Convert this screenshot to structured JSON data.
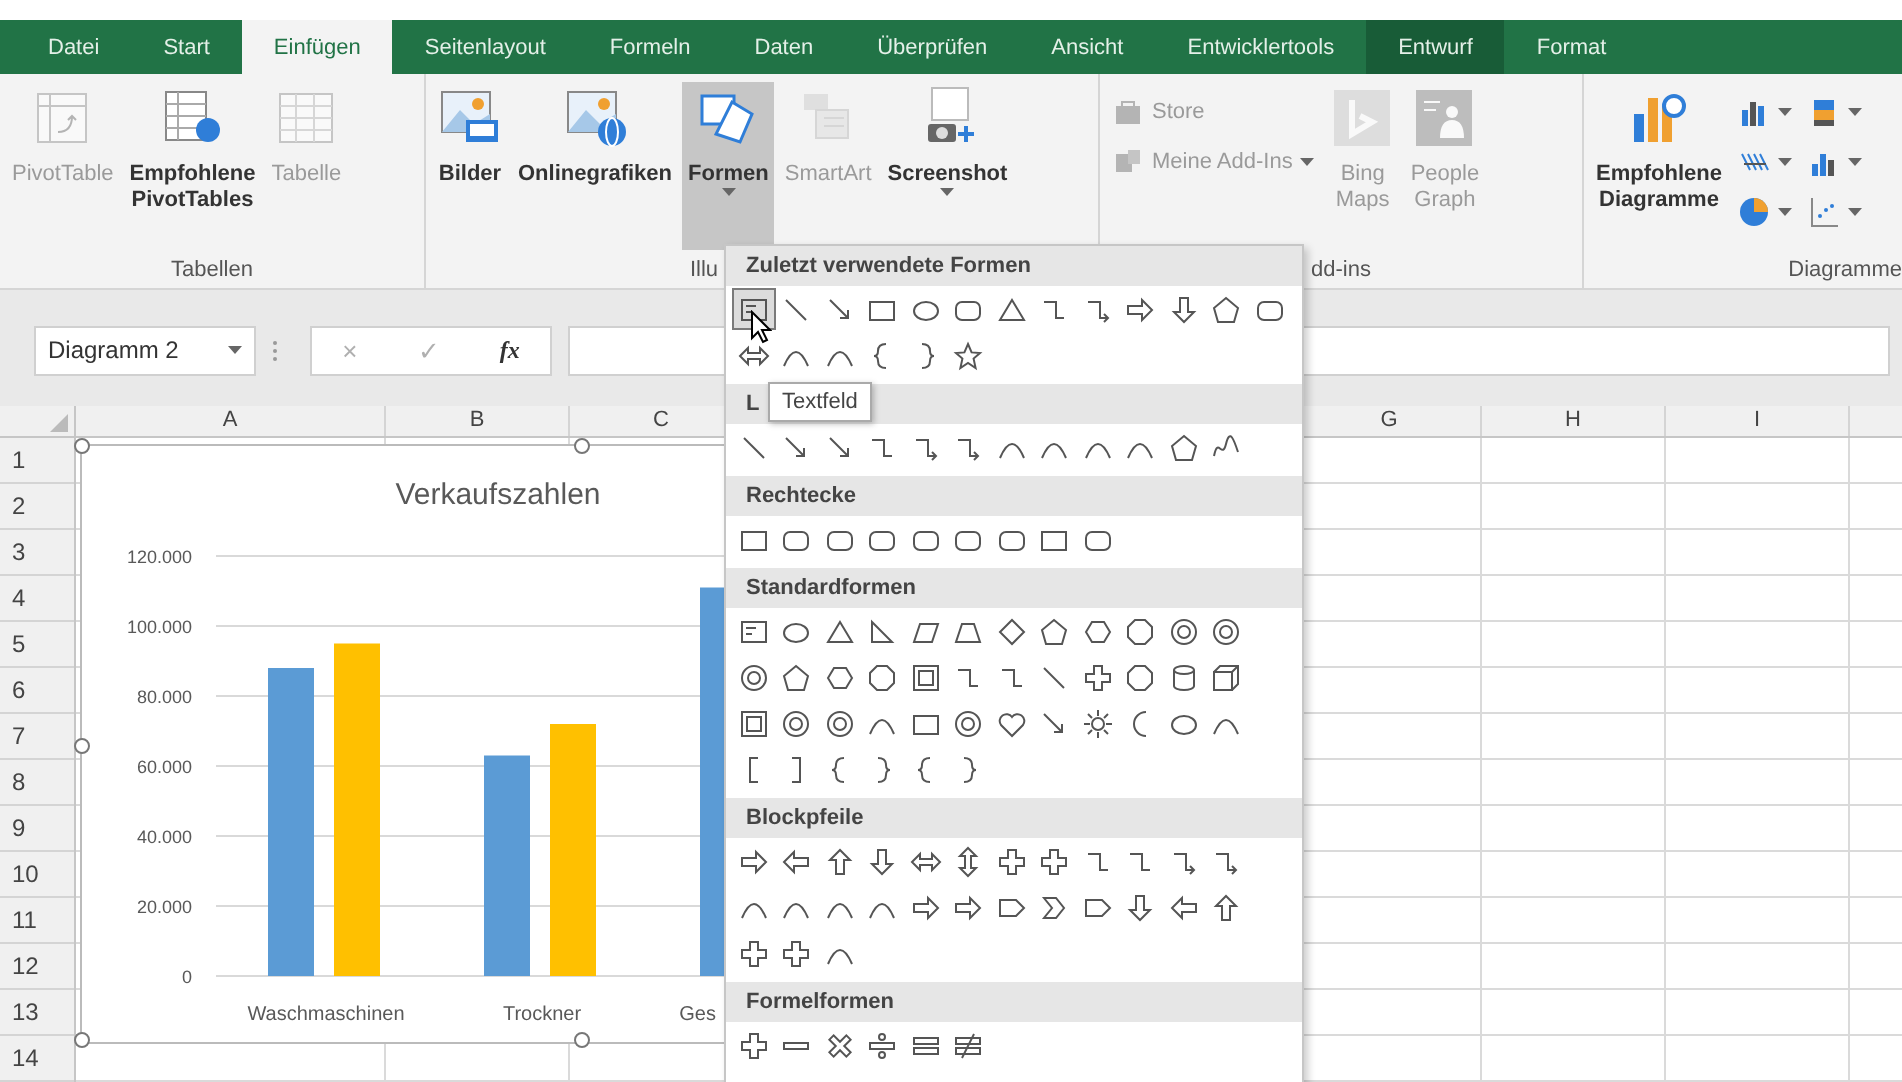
{
  "ribbon_tabs": [
    {
      "label": "Datei",
      "selected": false,
      "contextual": false
    },
    {
      "label": "Start",
      "selected": false,
      "contextual": false
    },
    {
      "label": "Einfügen",
      "selected": true,
      "contextual": false
    },
    {
      "label": "Seitenlayout",
      "selected": false,
      "contextual": false
    },
    {
      "label": "Formeln",
      "selected": false,
      "contextual": false
    },
    {
      "label": "Daten",
      "selected": false,
      "contextual": false
    },
    {
      "label": "Überprüfen",
      "selected": false,
      "contextual": false
    },
    {
      "label": "Ansicht",
      "selected": false,
      "contextual": false
    },
    {
      "label": "Entwicklertools",
      "selected": false,
      "contextual": false
    },
    {
      "label": "Entwurf",
      "selected": false,
      "contextual": true
    },
    {
      "label": "Format",
      "selected": false,
      "contextual": false
    }
  ],
  "ribbon_groups": [
    {
      "label": "Tabellen",
      "buttons": [
        {
          "kind": "large",
          "label": "PivotTable",
          "disabled": true,
          "pressed": false
        },
        {
          "kind": "large",
          "label": "Empfohlene PivotTables",
          "disabled": false,
          "pressed": false
        },
        {
          "kind": "large",
          "label": "Tabelle",
          "disabled": true,
          "pressed": false
        }
      ]
    },
    {
      "label": "Illu",
      "buttons": [
        {
          "kind": "large",
          "label": "Bilder",
          "disabled": false,
          "pressed": false
        },
        {
          "kind": "large",
          "label": "Onlinegrafiken",
          "disabled": false,
          "pressed": false
        },
        {
          "kind": "large-menu",
          "label": "Formen",
          "disabled": false,
          "pressed": true
        },
        {
          "kind": "large",
          "label": "SmartArt",
          "disabled": true,
          "pressed": false
        },
        {
          "kind": "large-menu",
          "label": "Screenshot",
          "disabled": false,
          "pressed": false
        }
      ]
    },
    {
      "label": "dd-ins",
      "buttons": [
        {
          "kind": "small",
          "label": "Store",
          "disabled": true,
          "pressed": false
        },
        {
          "kind": "small-menu",
          "label": "Meine Add-Ins",
          "disabled": true,
          "pressed": false
        },
        {
          "kind": "large",
          "label": "Bing Maps",
          "disabled": true,
          "pressed": false
        },
        {
          "kind": "large",
          "label": "People Graph",
          "disabled": true,
          "pressed": false
        }
      ]
    },
    {
      "label": "Diagramme",
      "buttons": [
        {
          "kind": "large",
          "label": "Empfohlene Diagramme",
          "disabled": false,
          "pressed": false
        },
        {
          "kind": "small-menu",
          "disabled": false,
          "pressed": false
        },
        {
          "kind": "small-menu",
          "disabled": false,
          "pressed": false
        },
        {
          "kind": "small-menu",
          "disabled": false,
          "pressed": false
        },
        {
          "kind": "small-menu",
          "disabled": false,
          "pressed": false
        },
        {
          "kind": "small-menu",
          "disabled": false,
          "pressed": false
        },
        {
          "kind": "small-menu",
          "disabled": false,
          "pressed": false
        }
      ]
    }
  ],
  "formula_bar": {
    "name_box": "Diagramm 2",
    "buttons": [
      {
        "label": "×",
        "disabled": true
      },
      {
        "label": "✓",
        "disabled": true
      },
      {
        "label": "fx",
        "disabled": false
      }
    ]
  },
  "sheet": {
    "columns": [
      "A",
      "B",
      "C",
      "G",
      "H",
      "I"
    ],
    "rows": [
      "1",
      "2",
      "3",
      "4",
      "5",
      "6",
      "7",
      "8",
      "9",
      "10",
      "11",
      "12",
      "13",
      "14"
    ]
  },
  "chart": {
    "chart_data": {
      "type": "bar",
      "title": "Verkaufszahlen",
      "categories": [
        "Waschmaschinen",
        "Trockner",
        "Ges"
      ],
      "series": [
        {
          "color": "#5b9bd5",
          "values": [
            88000,
            63000,
            111000
          ]
        },
        {
          "color": "#ffc000",
          "values": [
            95000,
            72000,
            null
          ]
        }
      ],
      "ylim": [
        0,
        120000
      ],
      "grid": true,
      "yticks": [
        {
          "value": 0,
          "label": "0"
        },
        {
          "value": 20000,
          "label": "20.000"
        },
        {
          "value": 40000,
          "label": "40.000"
        },
        {
          "value": 60000,
          "label": "60.000"
        },
        {
          "value": 80000,
          "label": "80.000"
        },
        {
          "value": 100000,
          "label": "100.000"
        },
        {
          "value": 120000,
          "label": "120.000"
        }
      ]
    }
  },
  "shapes_menu": {
    "sections": [
      {
        "title": "Zuletzt verwendete Formen"
      },
      {
        "title": "L"
      },
      {
        "title": "Rechtecke"
      },
      {
        "title": "Standardformen"
      },
      {
        "title": "Blockpfeile"
      },
      {
        "title": "Formelformen"
      }
    ],
    "tooltip": "Textfeld"
  }
}
